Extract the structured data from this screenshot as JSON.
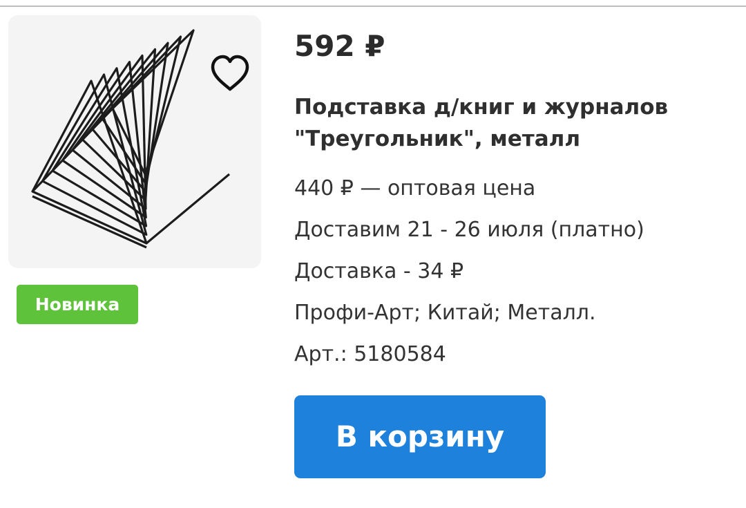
{
  "product": {
    "price": "592 ₽",
    "title": "Подставка д/книг и журналов \"Треугольник\", металл",
    "badge": "Новинка",
    "wholesale_price": "440 ₽ — оптовая цена",
    "delivery_date": "Доставим 21 - 26 июля (платно)",
    "delivery_cost": "Доставка - 34 ₽",
    "attributes": "Профи-Арт; Китай; Металл.",
    "article": "Арт.: 5180584",
    "image_icon": "triangle-wire-book-stand",
    "favorite_icon": "heart-outline-icon"
  },
  "actions": {
    "add_to_cart_label": "В корзину"
  },
  "colors": {
    "badge": "#5ec33b",
    "button": "#1e82dc",
    "image_bg": "#f4f4f4"
  }
}
